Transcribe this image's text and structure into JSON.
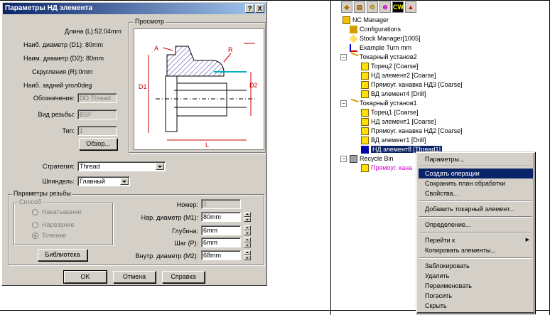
{
  "dialog": {
    "title": "Параметры НД элемента",
    "help_btn": "?",
    "close_btn": "X",
    "info": {
      "length": "Длина (L):52.04mm",
      "max_diam": "Наиб. диаметр (D1): 80mm",
      "min_diam": "Наим. диаметр (D2): 80mm",
      "rounding": "Скругления (R):0mm",
      "back_angle": "Наиб. задний угол0deg"
    },
    "designation_label": "Обозначение:",
    "designation_value": "DD Thread",
    "thread_type_label": "Вид резьбы:",
    "thread_type_value": "BSF",
    "type_label": "Тип:",
    "type_value": "1",
    "browse_btn": "Обзор...",
    "preview_title": "Просмотр",
    "preview_labels": {
      "a": "A",
      "r": "R",
      "d1": "D1",
      "d2": "D2",
      "l": "L"
    },
    "strategy_label": "Стратегия:",
    "strategy_value": "Thread",
    "spindle_label": "Шпиндель:",
    "spindle_value": "Главный",
    "thread_params": {
      "title": "Параметры резьбы",
      "method_title": "Способ",
      "methods": [
        "Накатывание",
        "Нарезание",
        "Точение"
      ],
      "number_label": "Номер:",
      "number_value": "1",
      "outer_diam_label": "Нар. диаметр (M1):",
      "outer_diam_value": "80mm",
      "depth_label": "Глубина:",
      "depth_value": "6mm",
      "pitch_label": "Шаг (P):",
      "pitch_value": "6mm",
      "inner_diam_label": "Внутр. диаметр (M2):",
      "inner_diam_value": "68mm",
      "library_btn": "Библиотека"
    },
    "ok_btn": "OK",
    "cancel_btn": "Отмена",
    "help_text_btn": "Справка"
  },
  "toolbar": {
    "cw_label": "CW"
  },
  "tree": {
    "root": "NC Manager",
    "configurations": "Configurations",
    "stock_manager": "Stock Manager[1005]",
    "example": "Example Turn mm",
    "setup2": "Токарный установ2",
    "setup2_items": [
      "Торец2 [Coarse]",
      "НД элемент2 [Coarse]",
      "Прямоуг. канавка НД3 [Coarse]",
      "ВД элемент4 [Drill]"
    ],
    "setup1": "Токарный установ1",
    "setup1_items": [
      "Торец1 [Coarse]",
      "НД элемент1 [Coarse]",
      "Прямоуг. канавка НД2 [Coarse]",
      "ВД элемент1 [Drill]"
    ],
    "selected": "НД элемент8 [Thread1]",
    "recycle": "Recycle Bin",
    "recycle_item": "Прямоуг. кана"
  },
  "menu": {
    "items": [
      "Параметры...",
      "Создать операции",
      "Сохранить план обработки",
      "Свойства...",
      "Добавить токарный элемент...",
      "Определение...",
      "Перейти к",
      "Копировать элементы...",
      "Заблокировать",
      "Удалить",
      "Переименовать",
      "Погасить",
      "Скрыть"
    ],
    "submenu_arrow": "▶"
  },
  "colors": {
    "title_start": "#0a246a",
    "title_end": "#a6caf0",
    "highlight": "#0a246a",
    "hatch": "#3333aa",
    "dim_red": "#cc0000",
    "magenta": "#d000d0"
  }
}
